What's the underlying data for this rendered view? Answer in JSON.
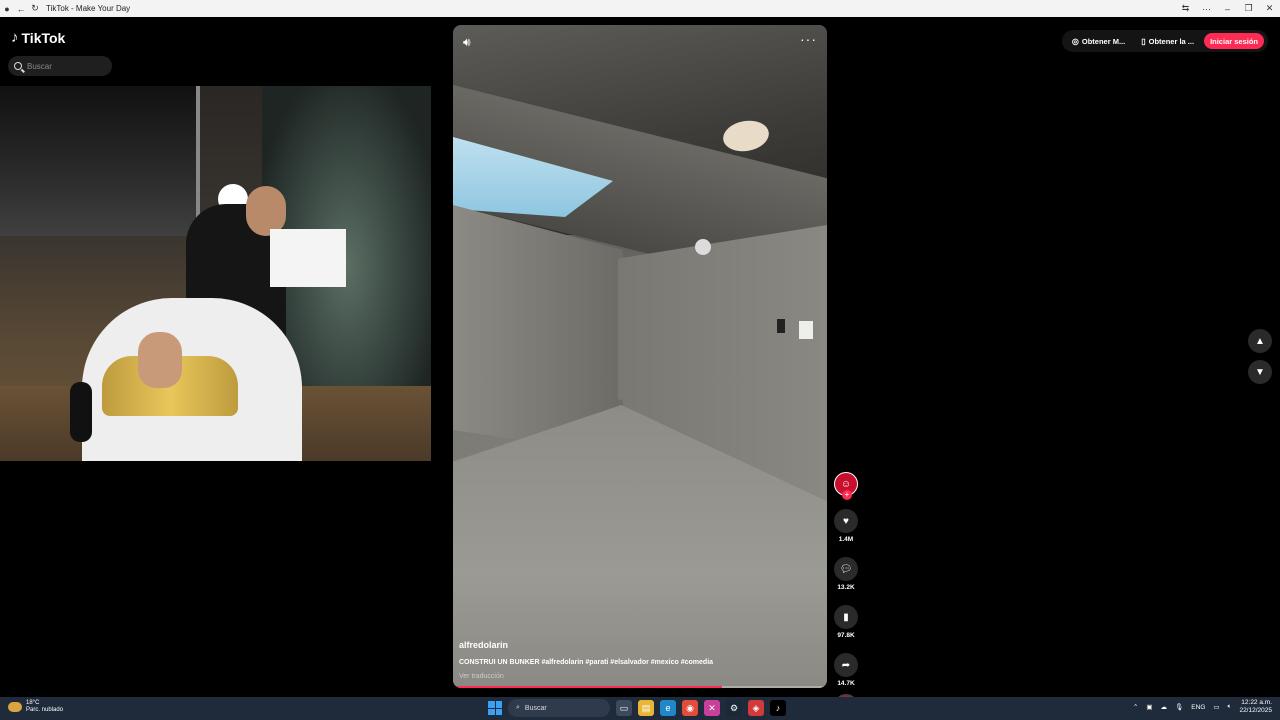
{
  "window": {
    "title": "TikTok - Make Your Day"
  },
  "header": {
    "logo_text": "TikTok",
    "search_placeholder": "Buscar",
    "get_app_label": "Obtener M...",
    "get_desktop_label": "Obtener la ...",
    "login_label": "Iniciar sesión",
    "accent_color": "#fe2c55"
  },
  "video": {
    "author": "alfredolarin",
    "description": "CONSTRUI UN BUNKER #alfredolarin #parati #elsalvador #mexico #comedia",
    "translate_label": "Ver traducción",
    "progress": 0.72
  },
  "actions": {
    "likes": "1.4M",
    "comments": "13.2K",
    "saves": "97.8K",
    "shares": "14.7K"
  },
  "taskbar": {
    "temperature": "18°C",
    "weather": "Parc. nublado",
    "search_label": "Buscar",
    "language": "ENG",
    "time": "12:22 a.m.",
    "date": "22/12/2025"
  }
}
